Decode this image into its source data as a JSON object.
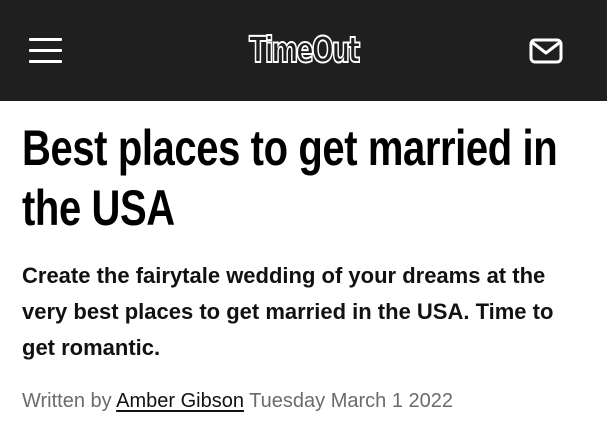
{
  "header": {
    "logo_text": "TimeOut",
    "menu_icon": "hamburger-menu-icon",
    "mail_icon": "envelope-icon",
    "background_color": "#1f1f1f"
  },
  "article": {
    "title": "Best places to get married in the USA",
    "standfirst": "Create the fairytale wedding of your dreams at the very best places to get married in the USA. Time to get romantic.",
    "byline_prefix": "Written by",
    "author": "Amber Gibson",
    "date": "Tuesday March 1 2022"
  }
}
